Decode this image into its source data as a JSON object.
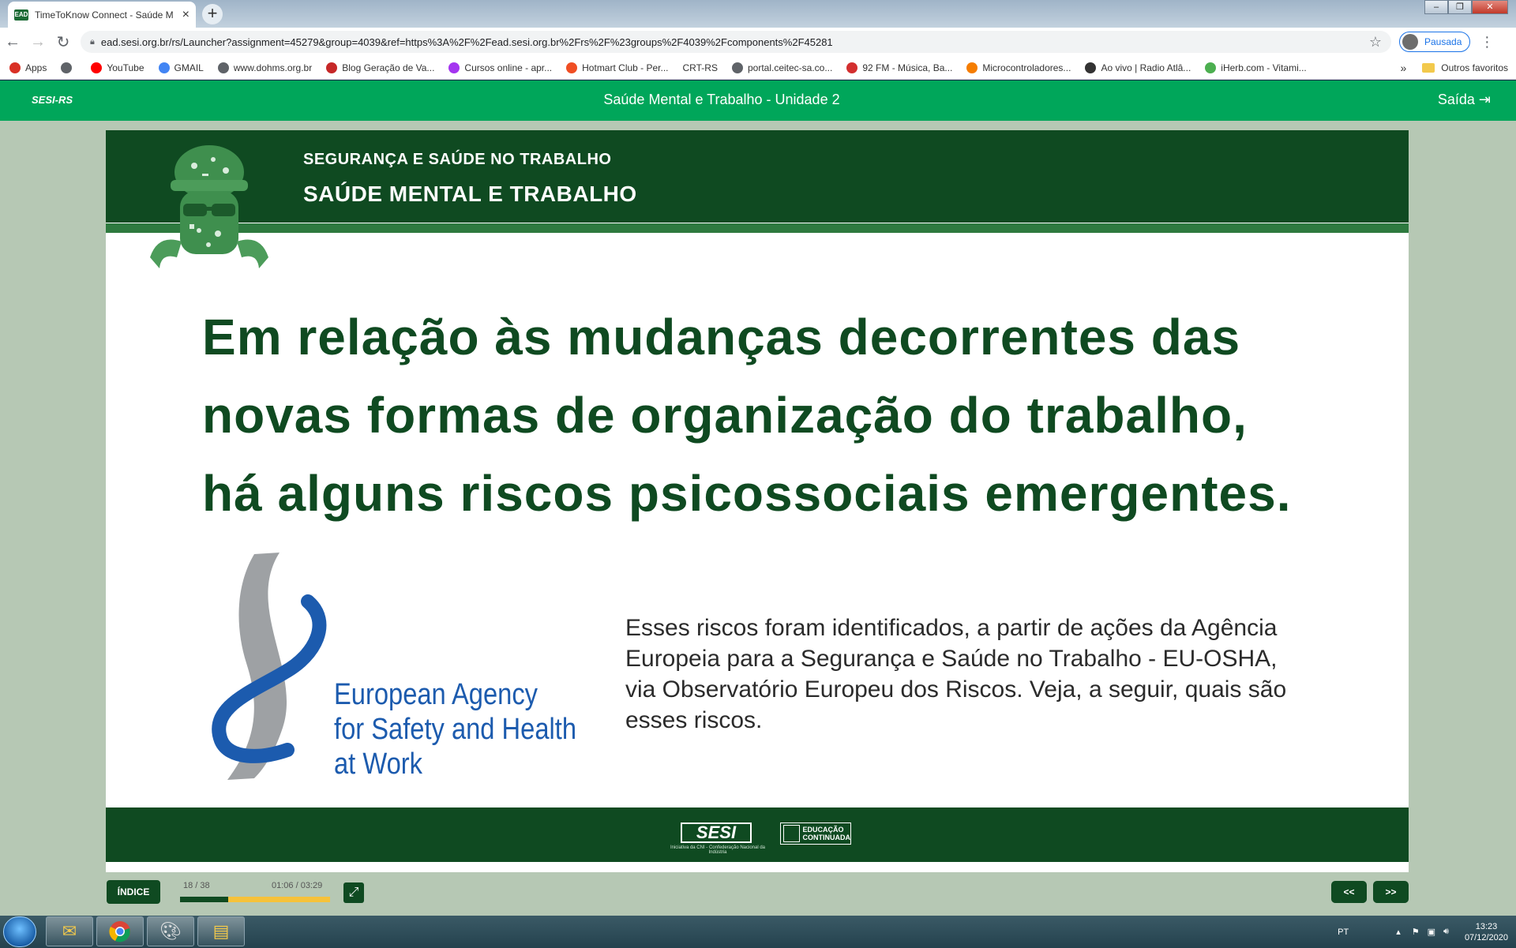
{
  "browser": {
    "tab_title": "TimeToKnow Connect - Saúde M",
    "tab_favicon": "EAD",
    "url": "ead.sesi.org.br/rs/Launcher?assignment=45279&group=4039&ref=https%3A%2F%2Fead.sesi.org.br%2Frs%2F%23groups%2F4039%2Fcomponents%2F45281",
    "profile_label": "Pausada",
    "bookmarks": [
      {
        "label": "Apps",
        "icon": "apps-grid-icon",
        "color": "#d93025"
      },
      {
        "label": "",
        "icon": "globe-icon",
        "color": "#5f6368"
      },
      {
        "label": "YouTube",
        "icon": "youtube-icon",
        "color": "#ff0000"
      },
      {
        "label": "GMAIL",
        "icon": "google-icon",
        "color": "#4285f4"
      },
      {
        "label": "www.dohms.org.br",
        "icon": "globe-icon",
        "color": "#5f6368"
      },
      {
        "label": "Blog Geração de Va...",
        "icon": "club-icon",
        "color": "#c62828"
      },
      {
        "label": "Cursos online - apr...",
        "icon": "udemy-icon",
        "color": "#a435f0"
      },
      {
        "label": "Hotmart Club - Per...",
        "icon": "flame-icon",
        "color": "#f04e23"
      },
      {
        "label": "CRT-RS",
        "icon": "",
        "color": "#ffffff"
      },
      {
        "label": "portal.ceitec-sa.co...",
        "icon": "globe-icon",
        "color": "#5f6368"
      },
      {
        "label": "92 FM - Música, Ba...",
        "icon": "radio-92-icon",
        "color": "#d32f2f"
      },
      {
        "label": "Microcontroladores...",
        "icon": "blogger-icon",
        "color": "#f57d00"
      },
      {
        "label": "Ao vivo | Radio Atlâ...",
        "icon": "radio-icon",
        "color": "#333333"
      },
      {
        "label": "iHerb.com - Vitami...",
        "icon": "leaf-icon",
        "color": "#4caf50"
      }
    ],
    "bookmarks_more": "»",
    "other_bookmarks": "Outros favoritos"
  },
  "app": {
    "brand": "SESI-RS",
    "title": "Saúde Mental e Trabalho - Unidade 2",
    "exit_label": "Saída"
  },
  "slide": {
    "header_small": "SEGURANÇA E SAÚDE NO TRABALHO",
    "header_big": "SAÚDE MENTAL E TRABALHO",
    "headline_lines": [
      "Em relação às mudanças decorrentes das",
      "novas formas de organização do trabalho,",
      "há alguns riscos psicossociais emergentes."
    ],
    "logo_text_lines": [
      "European Agency",
      "for Safety and Health",
      "at Work"
    ],
    "description": "Esses riscos foram identificados, a partir de ações da Agência Europeia para a Segurança e Saúde no Trabalho - EU-OSHA, via Observatório Europeu dos Riscos. Veja, a seguir, quais são esses riscos.",
    "footer_sesi": "SESI",
    "footer_sesi_sub": "Iniciativa da CNI - Confederação Nacional da Indústria",
    "footer_educ_line1": "EDUCAÇÃO",
    "footer_educ_line2": "CONTINUADA"
  },
  "controls": {
    "index_label": "ÍNDICE",
    "slide_counter": "18 / 38",
    "time": "01:06 / 03:29",
    "progress_fraction": 0.32,
    "prev_label": "<<",
    "next_label": ">>"
  },
  "taskbar": {
    "language": "PT",
    "time": "13:23",
    "date": "07/12/2020"
  },
  "colors": {
    "app_green": "#00a65a",
    "slide_dark_green": "#0f4a21",
    "osha_blue": "#1c5bae",
    "progress_yellow": "#f6c23a"
  }
}
